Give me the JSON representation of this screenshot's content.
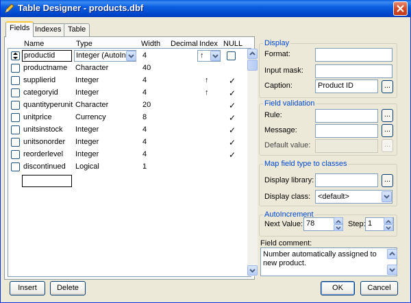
{
  "window": {
    "title": "Table Designer - products.dbf"
  },
  "tabs": [
    {
      "label": "Fields",
      "active": true
    },
    {
      "label": "Indexes",
      "active": false
    },
    {
      "label": "Table",
      "active": false
    }
  ],
  "grid": {
    "headers": {
      "name": "Name",
      "type": "Type",
      "width": "Width",
      "decimal": "Decimal",
      "index": "Index",
      "null": "NULL"
    },
    "rows": [
      {
        "name": "productid",
        "type": "Integer (AutoInc",
        "width": "4",
        "index": "↑",
        "null": "",
        "selected": true
      },
      {
        "name": "productname",
        "type": "Character",
        "width": "40",
        "index": "",
        "null": ""
      },
      {
        "name": "supplierid",
        "type": "Integer",
        "width": "4",
        "index": "↑",
        "null": "✓"
      },
      {
        "name": "categoryid",
        "type": "Integer",
        "width": "4",
        "index": "↑",
        "null": "✓"
      },
      {
        "name": "quantityperunit",
        "type": "Character",
        "width": "20",
        "index": "",
        "null": "✓"
      },
      {
        "name": "unitprice",
        "type": "Currency",
        "width": "8",
        "index": "",
        "null": "✓"
      },
      {
        "name": "unitsinstock",
        "type": "Integer",
        "width": "4",
        "index": "",
        "null": "✓"
      },
      {
        "name": "unitsonorder",
        "type": "Integer",
        "width": "4",
        "index": "",
        "null": "✓"
      },
      {
        "name": "reorderlevel",
        "type": "Integer",
        "width": "4",
        "index": "",
        "null": "✓"
      },
      {
        "name": "discontinued",
        "type": "Logical",
        "width": "1",
        "index": "",
        "null": ""
      }
    ]
  },
  "display": {
    "title": "Display",
    "format_label": "Format:",
    "format_value": "",
    "input_mask_label": "Input mask:",
    "input_mask_value": "",
    "caption_label": "Caption:",
    "caption_value": "Product ID"
  },
  "validation": {
    "title": "Field validation",
    "rule_label": "Rule:",
    "message_label": "Message:",
    "default_label": "Default value:"
  },
  "mapping": {
    "title": "Map field type to classes",
    "library_label": "Display library:",
    "class_label": "Display class:",
    "class_value": "<default>"
  },
  "autoinc": {
    "title": "AutoIncrement",
    "next_label": "Next Value:",
    "next_value": "78",
    "step_label": "Step:",
    "step_value": "1"
  },
  "comment": {
    "label": "Field comment:",
    "value": "Number automatically assigned to new product."
  },
  "buttons": {
    "insert": "Insert",
    "delete": "Delete",
    "ok": "OK",
    "cancel": "Cancel",
    "ellipsis": "..."
  },
  "colors": {
    "titlebar": "#0054e3",
    "group_title": "#0046d5",
    "dialog_bg": "#ece9d8"
  }
}
